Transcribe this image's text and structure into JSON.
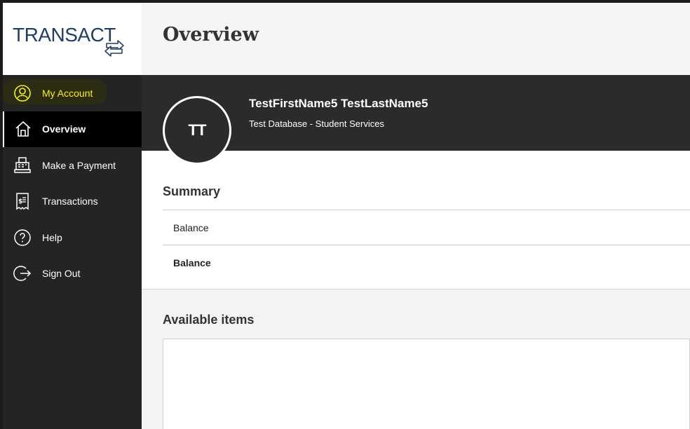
{
  "brand": {
    "logo_text": "TRANSACT"
  },
  "page": {
    "title": "Overview"
  },
  "sidebar": {
    "items": [
      {
        "label": "My Account",
        "icon": "user-circle-icon",
        "highlighted": true
      },
      {
        "label": "Overview",
        "icon": "home-icon",
        "active": true
      },
      {
        "label": "Make a Payment",
        "icon": "register-icon"
      },
      {
        "label": "Transactions",
        "icon": "receipt-icon"
      },
      {
        "label": "Help",
        "icon": "help-icon"
      },
      {
        "label": "Sign Out",
        "icon": "sign-out-icon"
      }
    ]
  },
  "profile": {
    "initials": "TT",
    "name": "TestFirstName5 TestLastName5",
    "subtitle": "Test Database - Student Services"
  },
  "summary": {
    "title": "Summary",
    "rows": [
      {
        "label": "Balance"
      },
      {
        "label": "Balance"
      }
    ]
  },
  "available": {
    "title": "Available items"
  },
  "colors": {
    "sidebar_bg": "#242424",
    "active_bg": "#000000",
    "highlight_text": "#f5f21a",
    "profile_bg": "#2b2b2b",
    "logo_color": "#1f3f5f"
  }
}
